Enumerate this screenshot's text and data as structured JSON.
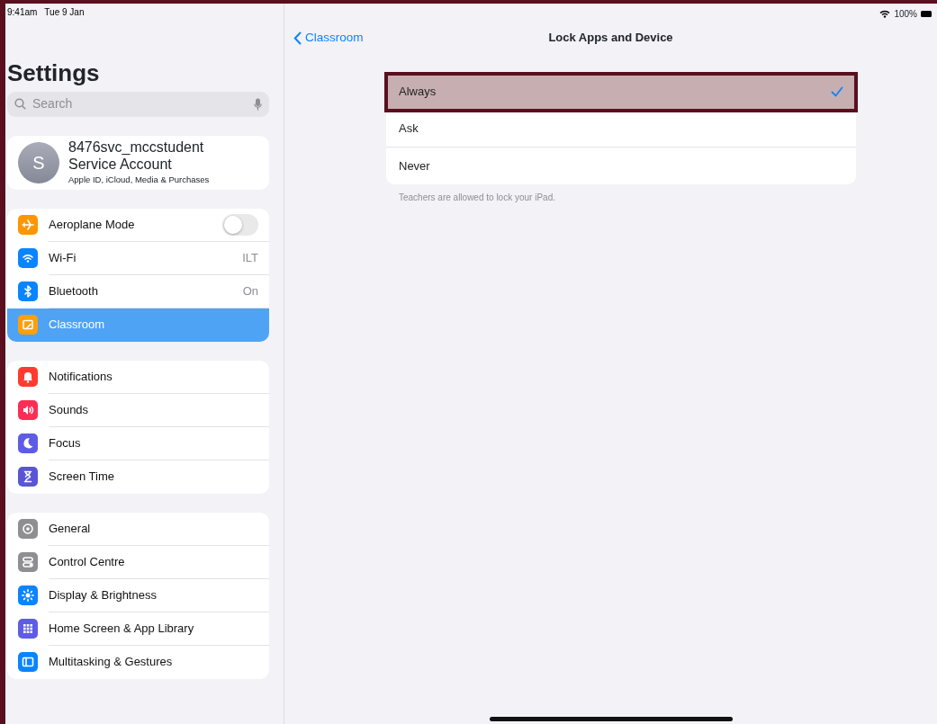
{
  "status_bar": {
    "time": "9:41am",
    "date": "Tue 9 Jan",
    "battery": "100%"
  },
  "sidebar": {
    "title": "Settings",
    "search": {
      "placeholder": "Search"
    },
    "account": {
      "initial": "S",
      "name": "8476svc_mccstudent",
      "subtitle": "Service Account",
      "detail": "Apple ID, iCloud, Media & Purchases"
    },
    "groups": [
      {
        "items": [
          {
            "label": "Aeroplane Mode",
            "kind": "toggle",
            "on": false,
            "selected": false,
            "color": "#ff9500"
          },
          {
            "label": "Wi-Fi",
            "kind": "value",
            "value": "ILT",
            "selected": false,
            "color": "#0a84ff"
          },
          {
            "label": "Bluetooth",
            "kind": "value",
            "value": "On",
            "selected": false,
            "color": "#0a84ff"
          },
          {
            "label": "Classroom",
            "kind": "plain",
            "selected": true,
            "color": "#ff9f0a"
          }
        ]
      },
      {
        "items": [
          {
            "label": "Notifications",
            "kind": "plain",
            "selected": false,
            "color": "#ff3b30"
          },
          {
            "label": "Sounds",
            "kind": "plain",
            "selected": false,
            "color": "#ff2d55"
          },
          {
            "label": "Focus",
            "kind": "plain",
            "selected": false,
            "color": "#5e5ce6"
          },
          {
            "label": "Screen Time",
            "kind": "plain",
            "selected": false,
            "color": "#5856d6"
          }
        ]
      },
      {
        "items": [
          {
            "label": "General",
            "kind": "plain",
            "selected": false,
            "color": "#8e8e93"
          },
          {
            "label": "Control Centre",
            "kind": "plain",
            "selected": false,
            "color": "#8e8e93"
          },
          {
            "label": "Display & Brightness",
            "kind": "plain",
            "selected": false,
            "color": "#0a84ff"
          },
          {
            "label": "Home Screen & App Library",
            "kind": "plain",
            "selected": false,
            "color": "#5e5ce6"
          },
          {
            "label": "Multitasking & Gestures",
            "kind": "plain",
            "selected": false,
            "color": "#0a84ff"
          }
        ]
      }
    ]
  },
  "detail": {
    "back": "Classroom",
    "title": "Lock Apps and Device",
    "options": [
      {
        "label": "Always",
        "selected": true
      },
      {
        "label": "Ask",
        "selected": false
      },
      {
        "label": "Never",
        "selected": false
      }
    ],
    "footer": "Teachers are allowed to lock your iPad."
  }
}
